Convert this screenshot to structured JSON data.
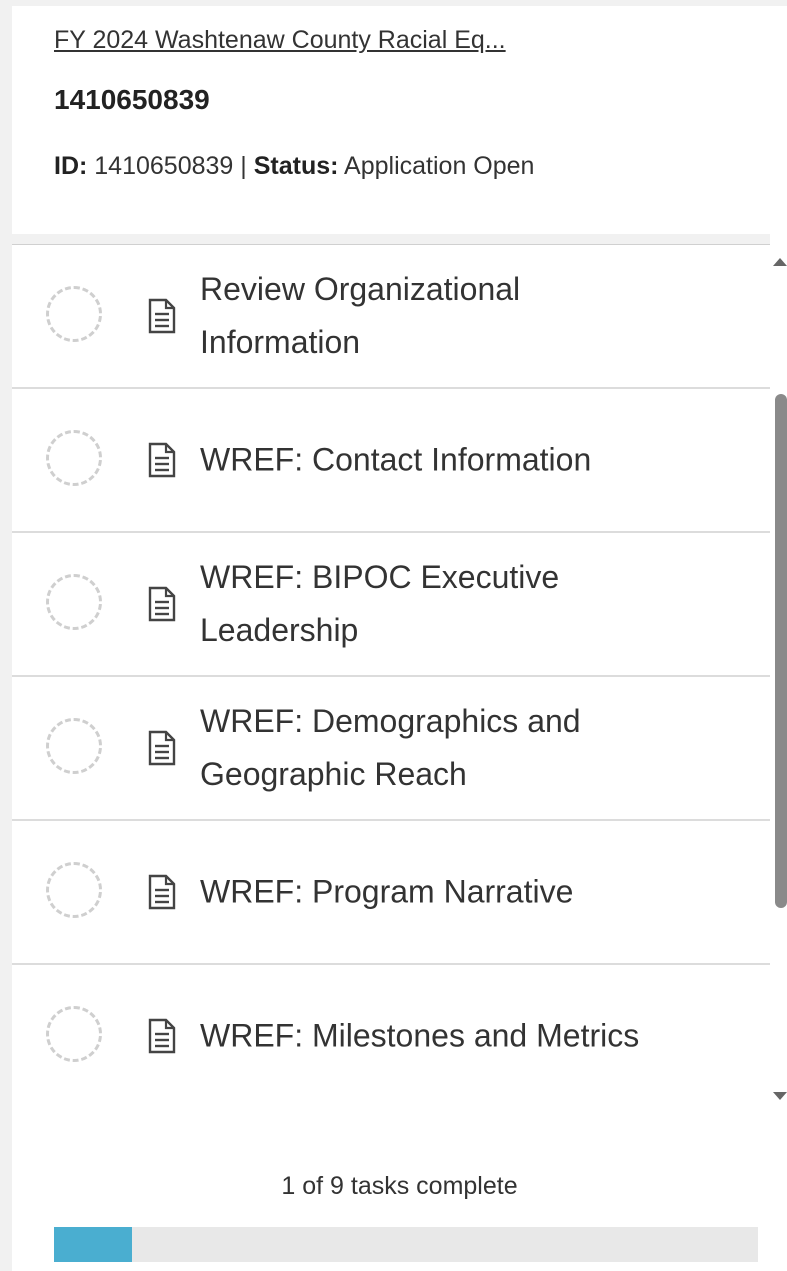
{
  "header": {
    "app_link": "FY 2024 Washtenaw County Racial Eq...",
    "record_title": "1410650839",
    "id_label": "ID:",
    "id_value": "1410650839",
    "separator": "|",
    "status_label": "Status:",
    "status_value": "Application Open"
  },
  "tasks": [
    {
      "label": "Review Organizational Information",
      "status_icon": "incomplete-circle-icon",
      "type_icon": "document-icon"
    },
    {
      "label": "WREF: Contact Information",
      "status_icon": "incomplete-circle-icon",
      "type_icon": "document-icon"
    },
    {
      "label": "WREF: BIPOC Executive Leadership",
      "status_icon": "incomplete-circle-icon",
      "type_icon": "document-icon"
    },
    {
      "label": "WREF: Demographics and Geographic Reach",
      "status_icon": "incomplete-circle-icon",
      "type_icon": "document-icon"
    },
    {
      "label": "WREF: Program Narrative",
      "status_icon": "incomplete-circle-icon",
      "type_icon": "document-icon"
    },
    {
      "label": "WREF: Milestones and Metrics",
      "status_icon": "incomplete-circle-icon",
      "type_icon": "document-icon"
    }
  ],
  "footer": {
    "progress_text": "1 of 9 tasks complete",
    "completed": 1,
    "total": 9
  },
  "colors": {
    "progress_fill": "#4aaed0",
    "progress_track": "#e8e8e8"
  }
}
